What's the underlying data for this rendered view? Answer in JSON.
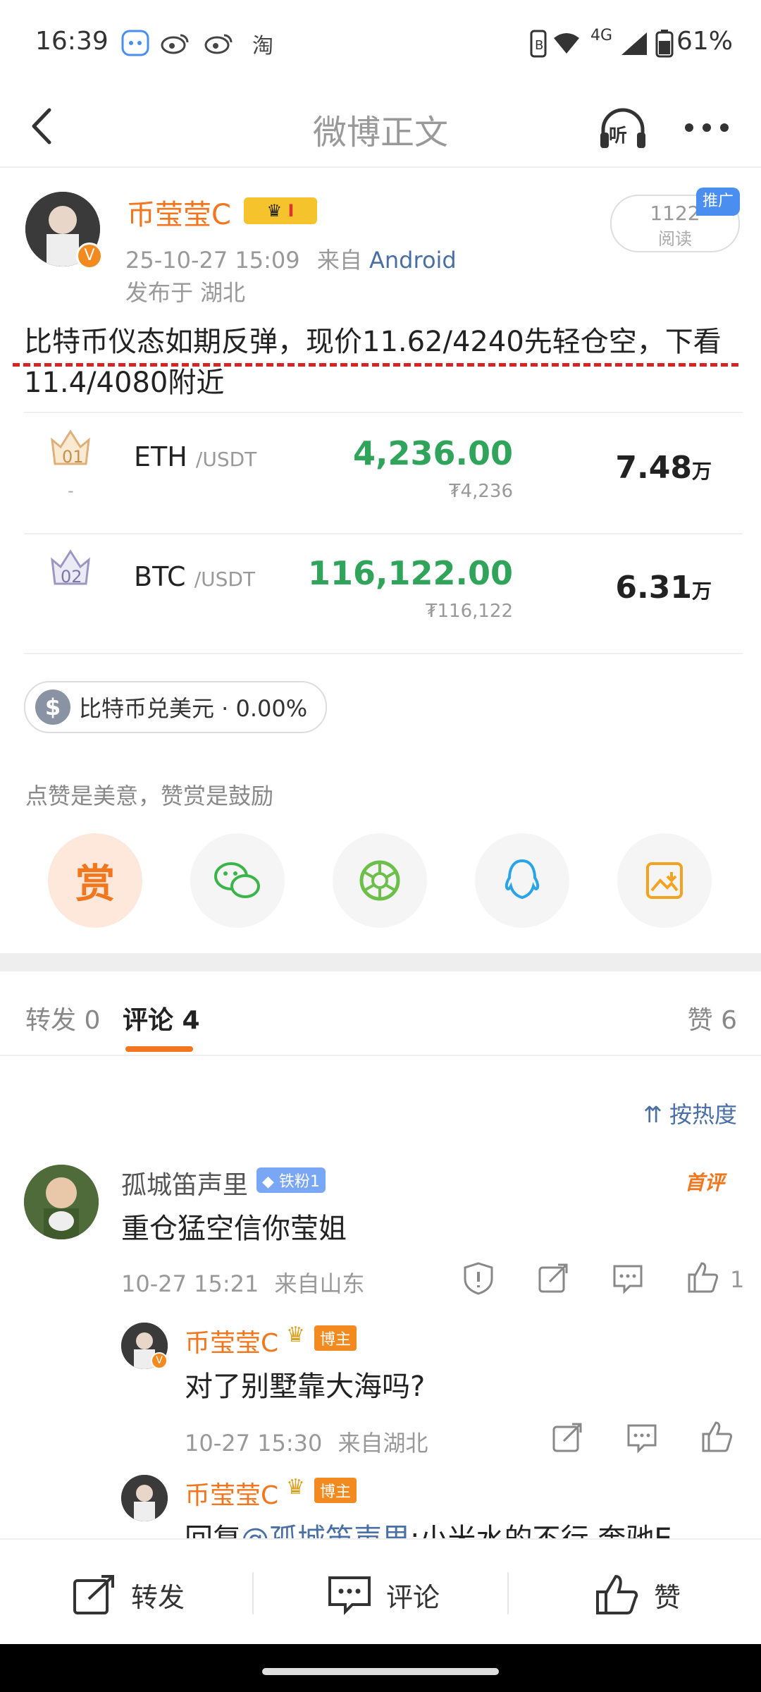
{
  "status_bar": {
    "time": "16:39",
    "app_icons": [
      "qq-browser-icon",
      "weibo-icon",
      "weibo-icon",
      "taobao-icon"
    ],
    "taobao": "淘",
    "network": "4G",
    "battery": "61%"
  },
  "header": {
    "title": "微博正文",
    "listen": "听"
  },
  "post": {
    "author": "币莹莹C",
    "crown_level": "I",
    "v_badge": "V",
    "time": "25-10-27 15:09",
    "source_prefix": "来自",
    "source": "Android",
    "location": "发布于 湖北",
    "reads": "1122",
    "reads_label": "阅读",
    "promo": "推广",
    "text": "比特币仪态如期反弹，现价11.62/4240先轻仓空，下看11.4/4080附近"
  },
  "market": [
    {
      "rank": "01",
      "symbol": "ETH",
      "pair": "/USDT",
      "price": "4,236.00",
      "cny": "₮4,236",
      "volume": "7.48",
      "unit": "万",
      "sub": "-"
    },
    {
      "rank": "02",
      "symbol": "BTC",
      "pair": "/USDT",
      "price": "116,122.00",
      "cny": "₮116,122",
      "volume": "6.31",
      "unit": "万"
    }
  ],
  "chip": {
    "symbol": "$",
    "text": "比特币兑美元 · 0.00%"
  },
  "tip_text": "点赞是美意，赞赏是鼓励",
  "share": {
    "reward": "赏"
  },
  "tabs": {
    "repost": "转发 0",
    "comments": "评论 4",
    "likes": "赞 6"
  },
  "sort_label": "按热度",
  "comments": [
    {
      "name": "孤城笛声里",
      "badge": "铁粉1",
      "tag": "首评",
      "text": "重仓猛空信你莹姐",
      "time": "10-27 15:21",
      "loc": "来自山东",
      "likes": "1"
    },
    {
      "name": "币莹莹C",
      "badge": "博主",
      "text": "对了别墅靠大海吗?",
      "time": "10-27 15:30",
      "loc": "来自湖北"
    },
    {
      "name": "币莹莹C",
      "badge": "博主",
      "text_prefix": "回复",
      "mention": "@孤城笛声里",
      "text": ":小米水的不行 奔驰E"
    }
  ],
  "bottom": {
    "repost": "转发",
    "comment": "评论",
    "like": "赞"
  },
  "colors": {
    "accent": "#f2761d",
    "green": "#2fa45a",
    "link": "#4a6fa5"
  }
}
